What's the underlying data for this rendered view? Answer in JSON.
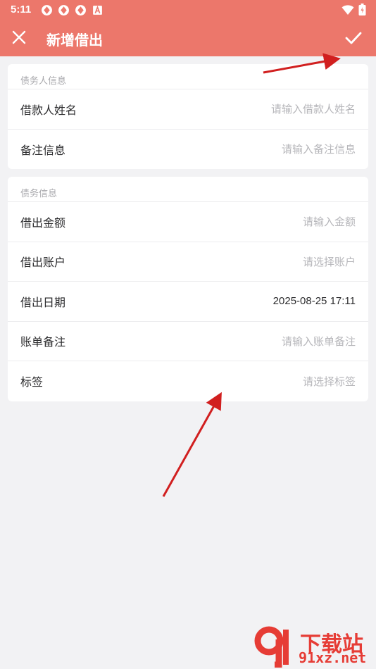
{
  "status_bar": {
    "time": "5:11",
    "left_icons": [
      "app-notification-icon",
      "app-notification-icon",
      "app-notification-icon",
      "a-badge-icon"
    ],
    "right_icons": [
      "wifi-icon",
      "battery-icon"
    ]
  },
  "app_bar": {
    "title": "新增借出",
    "close_icon": "close-icon",
    "confirm_icon": "check-icon",
    "background": "#ec776b"
  },
  "debtor_section": {
    "header": "债务人信息",
    "rows": [
      {
        "label": "借款人姓名",
        "value": "请输入借款人姓名"
      },
      {
        "label": "备注信息",
        "value": "请输入备注信息"
      }
    ]
  },
  "debt_section": {
    "header": "债务信息",
    "rows": [
      {
        "label": "借出金额",
        "value": "请输入金额"
      },
      {
        "label": "借出账户",
        "value": "请选择账户"
      },
      {
        "label": "借出日期",
        "value": "2025-08-25 17:11"
      },
      {
        "label": "账单备注",
        "value": "请输入账单备注"
      },
      {
        "label": "标签",
        "value": "请选择标签"
      }
    ]
  },
  "watermark": {
    "logo_text": "下载站",
    "domain": "91xz.net"
  }
}
